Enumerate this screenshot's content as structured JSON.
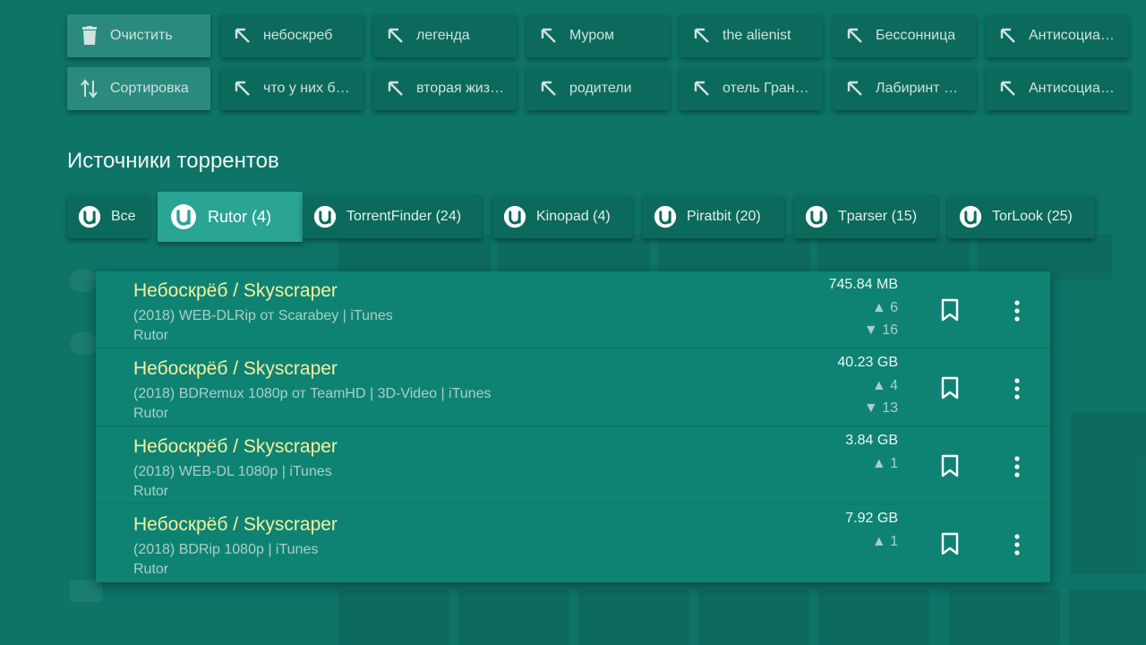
{
  "history": {
    "actions": [
      {
        "label": "Очистить",
        "icon": "trash-icon"
      },
      {
        "label": "Сортировка",
        "icon": "sort-icon"
      }
    ],
    "row1": [
      "небоскреб",
      "легенда",
      "Муром",
      "the alienist",
      "Бессонница",
      "Антисоциалка"
    ],
    "row2": [
      "что у них бы…",
      "вторая жизн…",
      "родители",
      "отель Гранд…",
      "Лабиринт фа…",
      "Антисоциалк…"
    ]
  },
  "section_title": "Источники торрентов",
  "sources": [
    {
      "label": "Все",
      "active": false
    },
    {
      "label": "Rutor (4)",
      "active": true
    },
    {
      "label": "TorrentFinder (24)",
      "active": false
    },
    {
      "label": "Kinopad (4)",
      "active": false
    },
    {
      "label": "Piratbit (20)",
      "active": false
    },
    {
      "label": "Tparser (15)",
      "active": false
    },
    {
      "label": "TorLook (25)",
      "active": false
    }
  ],
  "results": [
    {
      "title": "Небоскрёб / Skyscraper",
      "sub": "(2018) WEB-DLRip от Scarabey | iTunes",
      "tracker": "Rutor",
      "size": "745.84 MB",
      "seeds": "▲ 6",
      "peers": "▼ 16"
    },
    {
      "title": "Небоскрёб / Skyscraper",
      "sub": "(2018) BDRemux 1080p от TeamHD | 3D-Video | iTunes",
      "tracker": "Rutor",
      "size": "40.23 GB",
      "seeds": "▲ 4",
      "peers": "▼ 13"
    },
    {
      "title": "Небоскрёб / Skyscraper",
      "sub": "(2018) WEB-DL 1080p | iTunes",
      "tracker": "Rutor",
      "size": "3.84 GB",
      "seeds": "▲ 1",
      "peers": ""
    },
    {
      "title": "Небоскрёб / Skyscraper",
      "sub": "(2018) BDRip 1080p | iTunes",
      "tracker": "Rutor",
      "size": "7.92 GB",
      "seeds": "▲ 1",
      "peers": ""
    }
  ],
  "colors": {
    "background": "#0d7466",
    "chip": "#0c6a5c",
    "active_source": "#2aa493",
    "results_panel": "#0f8373",
    "title_text": "#f3f0a0"
  }
}
